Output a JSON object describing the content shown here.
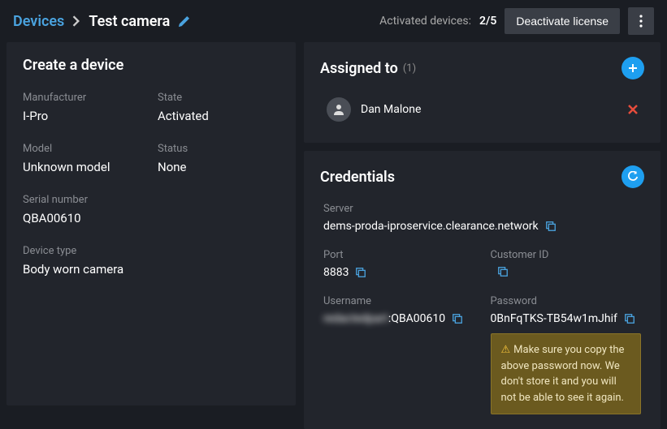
{
  "breadcrumb": {
    "root": "Devices",
    "current": "Test camera"
  },
  "header": {
    "activated_label": "Activated devices:",
    "activated_count": "2/5",
    "deactivate_btn": "Deactivate license"
  },
  "create_device": {
    "title": "Create a device",
    "fields": {
      "manufacturer_label": "Manufacturer",
      "manufacturer_value": "I-Pro",
      "state_label": "State",
      "state_value": "Activated",
      "model_label": "Model",
      "model_value": "Unknown model",
      "status_label": "Status",
      "status_value": "None",
      "serial_label": "Serial number",
      "serial_value": "QBA00610",
      "type_label": "Device type",
      "type_value": "Body worn camera"
    }
  },
  "assigned": {
    "title": "Assigned to",
    "count": "(1)",
    "items": [
      {
        "name": "Dan Malone"
      }
    ]
  },
  "credentials": {
    "title": "Credentials",
    "server_label": "Server",
    "server_value": "dems-proda-iproservice.clearance.network",
    "port_label": "Port",
    "port_value": "8883",
    "customer_label": "Customer ID",
    "customer_value": "",
    "username_label": "Username",
    "username_blur": "redactedpart",
    "username_suffix": ":QBA00610",
    "password_label": "Password",
    "password_value": "0BnFqTKS-TB54w1mJhif",
    "warning": "Make sure you copy the above password now. We don't store it and you will not be able to see it again."
  }
}
